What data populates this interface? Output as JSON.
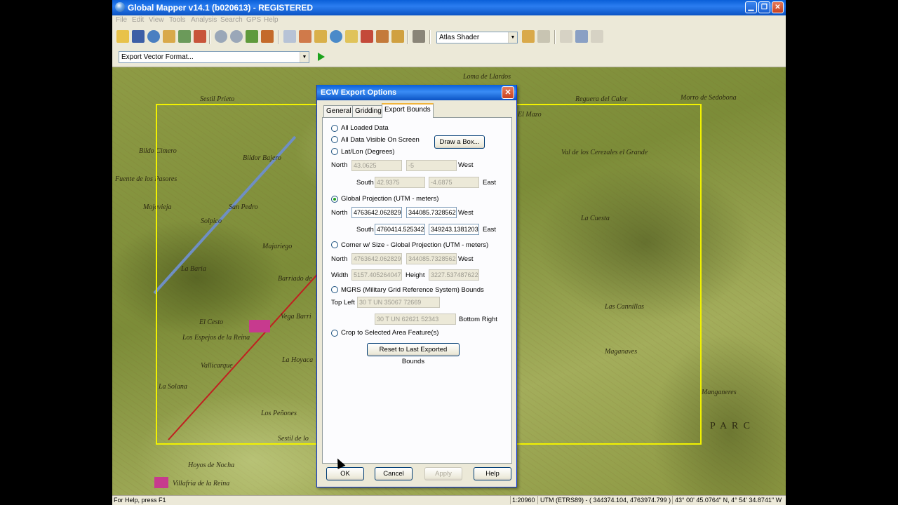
{
  "window": {
    "title": "Global Mapper v14.1 (b020613) - REGISTERED"
  },
  "menu": [
    "File",
    "Edit",
    "View",
    "Tools",
    "Analysis",
    "Search",
    "GPS",
    "Help"
  ],
  "toolbar": {
    "shader_select": "Atlas Shader",
    "export_format_select": "Export Vector Format..."
  },
  "map": {
    "labels": [
      "Loma de Llardos",
      "Sestil Prieto",
      "Reguera del Calor",
      "Morro de Sedobona",
      "El Mazo",
      "Bildo Cimero",
      "Bildor Bajero",
      "Val de los Cerezales el Grande",
      "Fuente de los Pasores",
      "Mojavieja",
      "San Pedro",
      "Solpico",
      "La Cuesta",
      "Majariego",
      "La Baria",
      "Barriado de",
      "El Cesto",
      "Vega Barri",
      "Los Espejos de la Reina",
      "Vallicarque",
      "La Hoyaca",
      "Las Cannillas",
      "La Solana",
      "Los Peñones",
      "Maganaves",
      "Sestil de lo",
      "Hoyos de Nocha",
      "Villafria de la Reina",
      "Manganeres",
      "P A R C"
    ]
  },
  "dialog": {
    "title": "ECW Export Options",
    "close_label": "✕",
    "tabs": [
      "General",
      "Gridding",
      "Export Bounds"
    ],
    "active_tab": "Export Bounds",
    "options": {
      "all_loaded": "All Loaded Data",
      "all_visible": "All Data Visible On Screen",
      "latlon": "Lat/Lon (Degrees)",
      "global_projection": "Global Projection (UTM - meters)",
      "corner_size": "Corner w/ Size - Global Projection (UTM - meters)",
      "mgrs": "MGRS (Military Grid Reference System) Bounds",
      "crop": "Crop to Selected Area Feature(s)"
    },
    "selected_option": "global_projection",
    "draw_box_button": "Draw a Box...",
    "reset_button": "Reset to Last Exported Bounds",
    "labels": {
      "north": "North",
      "south": "South",
      "east": "East",
      "west": "West",
      "width": "Width",
      "height": "Height",
      "top_left": "Top Left",
      "bottom_right": "Bottom Right"
    },
    "latlon": {
      "north": "43.0625",
      "west": "-5",
      "south": "42.9375",
      "east": "-4.6875"
    },
    "global": {
      "north": "4763642.062829",
      "west": "344085.7328562",
      "south": "4760414.525342",
      "east": "349243.1381203"
    },
    "corner": {
      "north": "4763642.062829",
      "west": "344085.7328562",
      "width": "5157.405264047",
      "height": "3227.537487622"
    },
    "mgrs": {
      "top_left": "30 T UN 35067 72669",
      "bottom_right": "30 T UN 62621 52343"
    },
    "buttons": {
      "ok": "OK",
      "cancel": "Cancel",
      "apply": "Apply",
      "help": "Help"
    }
  },
  "status": {
    "help_text": "For Help, press F1",
    "scale": "1:20960",
    "projection": "UTM (ETRS89) - ( 344374.104, 4763974.799 )",
    "latlon": "43° 00' 45.0764\" N, 4° 54' 34.8741\" W"
  },
  "colors": {
    "title_bar": "#0a5fd8",
    "bounds_rect": "#f2f200",
    "map_green": "#8e9b45"
  }
}
